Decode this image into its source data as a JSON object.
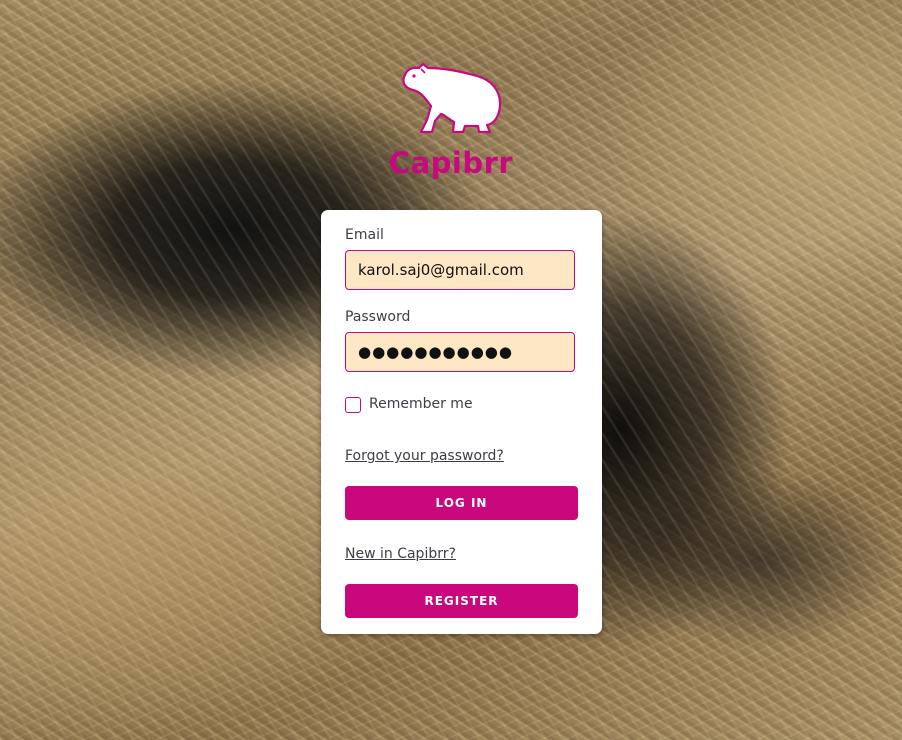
{
  "app": {
    "name": "Capibrr",
    "brand_color": "#c9087e",
    "logo_icon": "capybara-icon"
  },
  "login": {
    "email_label": "Email",
    "email_value": "karol.saj0@gmail.com",
    "password_label": "Password",
    "password_value": "●●●●●●●●●●●",
    "remember_label": "Remember me",
    "remember_checked": false,
    "forgot_link": "Forgot your password?",
    "login_button": "LOG IN",
    "new_user_link": "New in Capibrr?",
    "register_button": "REGISTER"
  }
}
